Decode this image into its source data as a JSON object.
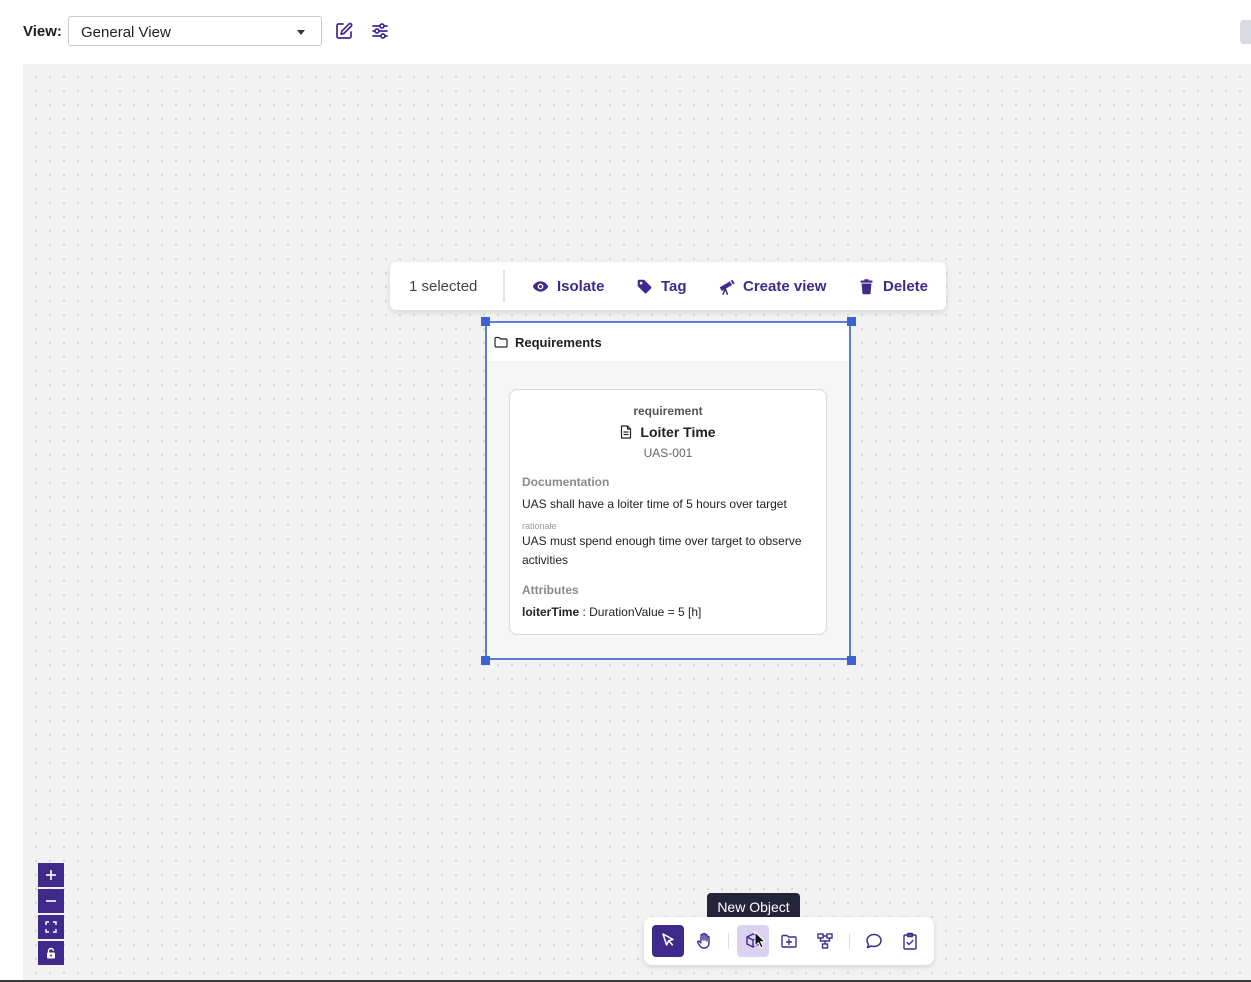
{
  "header": {
    "view_label": "View:",
    "view_select_value": "General View",
    "icons": [
      "edit-icon",
      "sliders-icon"
    ]
  },
  "selection_toolbar": {
    "count_label": "1 selected",
    "actions": [
      {
        "label": "Isolate",
        "icon": "eye-icon"
      },
      {
        "label": "Tag",
        "icon": "tag-icon"
      },
      {
        "label": "Create view",
        "icon": "telescope-icon"
      },
      {
        "label": "Delete",
        "icon": "trash-icon"
      }
    ]
  },
  "package": {
    "title": "Requirements",
    "icon": "folder-icon"
  },
  "requirement": {
    "kind": "requirement",
    "title": "Loiter Time",
    "id": "UAS-001",
    "documentation_heading": "Documentation",
    "documentation_text": "UAS shall have a loiter time of 5 hours over target",
    "rationale_label": "rationale",
    "rationale_text": "UAS must spend enough time over target to observe activities",
    "attributes_heading": "Attributes",
    "attribute_name": "loiterTime",
    "attribute_value": " : DurationValue = 5 [h]"
  },
  "zoom_controls": [
    "zoom-in-icon",
    "zoom-out-icon",
    "fit-view-icon",
    "lock-icon"
  ],
  "tool_bar": {
    "tools": [
      "select-icon",
      "pan-icon",
      "new-object-icon",
      "new-package-icon",
      "relationship-icon",
      "comment-icon",
      "requirement-icon"
    ],
    "active_tool": "select-icon",
    "hovered_tool": "new-object-icon",
    "tooltip": "New Object"
  },
  "colors": {
    "accent": "#3f2a8c",
    "selection_border": "#5b7fd9",
    "canvas_bg": "#f2f2f2",
    "tooltip_bg": "#25243b"
  }
}
